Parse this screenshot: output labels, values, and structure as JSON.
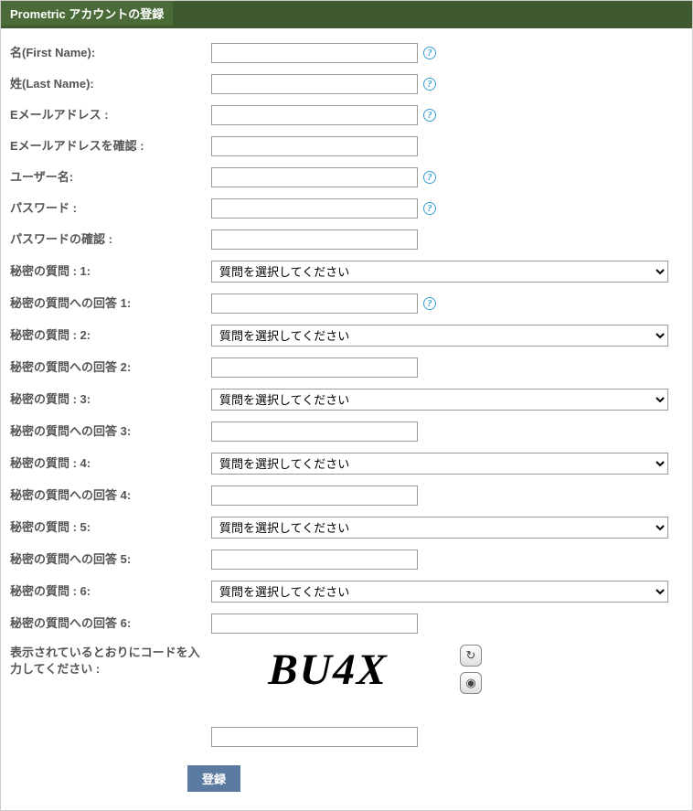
{
  "header": {
    "title": "Prometric アカウントの登録"
  },
  "labels": {
    "first_name": "名(First Name):",
    "last_name": "姓(Last Name):",
    "email": "Eメールアドレス :",
    "email_confirm": "Eメールアドレスを確認 :",
    "username": "ユーザー名:",
    "password": "パスワード :",
    "password_confirm": "パスワードの確認 :",
    "sq1": "秘密の質問 : 1:",
    "sa1": "秘密の質問への回答 1:",
    "sq2": "秘密の質問 : 2:",
    "sa2": "秘密の質問への回答 2:",
    "sq3": "秘密の質問 : 3:",
    "sa3": "秘密の質問への回答 3:",
    "sq4": "秘密の質問 : 4:",
    "sa4": "秘密の質問への回答 4:",
    "sq5": "秘密の質問 : 5:",
    "sa5": "秘密の質問への回答 5:",
    "sq6": "秘密の質問 : 6:",
    "sa6": "秘密の質問への回答 6:",
    "captcha": "表示されているとおりにコードを入力してください :"
  },
  "select_placeholder": "質問を選択してください",
  "captcha_text": "BU4X",
  "help_symbol": "?",
  "submit_label": "登録"
}
